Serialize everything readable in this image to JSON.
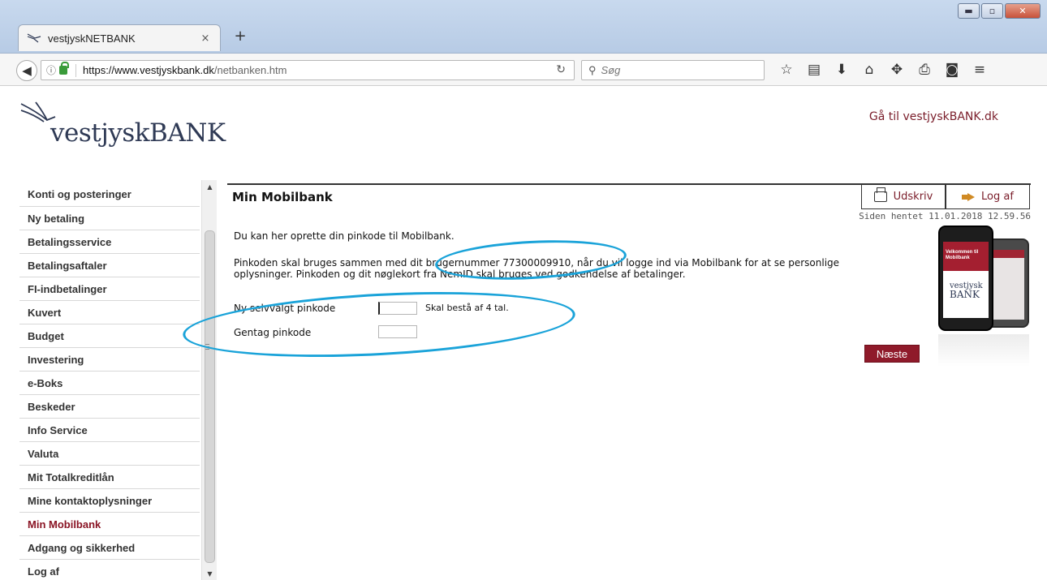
{
  "browser": {
    "tab_title": "vestjyskNETBANK",
    "tab_close": "×",
    "new_tab": "+",
    "url_domain": "https://www.vestjyskbank.dk",
    "url_path": "/netbanken.htm",
    "search_placeholder": "Søg",
    "window_controls": [
      "minimize",
      "maximize",
      "close"
    ],
    "toolbar_icons": [
      "bookmark-star-icon",
      "reading-list-icon",
      "download-icon",
      "home-icon",
      "extension-icon",
      "print-icon",
      "pocket-icon",
      "menu-icon"
    ]
  },
  "header": {
    "logo_text_1": "vestjysk",
    "logo_text_2": "BANK",
    "goto_link": "Gå til vestjyskBANK.dk"
  },
  "sidebar": {
    "items": [
      {
        "label": "Konti og posteringer"
      },
      {
        "label": "Ny betaling"
      },
      {
        "label": "Betalingsservice"
      },
      {
        "label": "Betalingsaftaler"
      },
      {
        "label": "FI-indbetalinger"
      },
      {
        "label": "Kuvert"
      },
      {
        "label": "Budget"
      },
      {
        "label": "Investering"
      },
      {
        "label": "e-Boks"
      },
      {
        "label": "Beskeder"
      },
      {
        "label": "Info Service"
      },
      {
        "label": "Valuta"
      },
      {
        "label": "Mit Totalkreditlån"
      },
      {
        "label": "Mine kontaktoplysninger"
      },
      {
        "label": "Min Mobilbank"
      },
      {
        "label": "Adgang og sikkerhed"
      },
      {
        "label": "Log af"
      }
    ],
    "active_index": 14
  },
  "main": {
    "title": "Min Mobilbank",
    "print_label": "Udskriv",
    "logoff_label": "Log af",
    "fetched": "Siden hentet 11.01.2018 12.59.56",
    "intro": "Du kan her oprette din pinkode til Mobilbank.",
    "info_line1": "Pinkoden skal bruges sammen med dit brugernummer 77300009910, når du vil logge ind via Mobilbank for at se personlige",
    "info_line2": "oplysninger. Pinkoden og dit nøglekort fra NemID skal bruges ved godkendelse af betalinger.",
    "form": {
      "new_pin_label": "Ny selvvalgt pinkode",
      "new_pin_value": "",
      "hint": "Skal bestå af 4 tal.",
      "repeat_pin_label": "Gentag pinkode",
      "repeat_pin_value": ""
    },
    "next_button": "Næste",
    "phone": {
      "welcome": "Velkommen til Mobilbank",
      "logo_1": "vestjysk",
      "logo_2": "BANK"
    }
  },
  "colors": {
    "brand_red": "#8f1a2a",
    "brand_navy": "#2f3a55",
    "annotation_blue": "#1aa3d9"
  }
}
